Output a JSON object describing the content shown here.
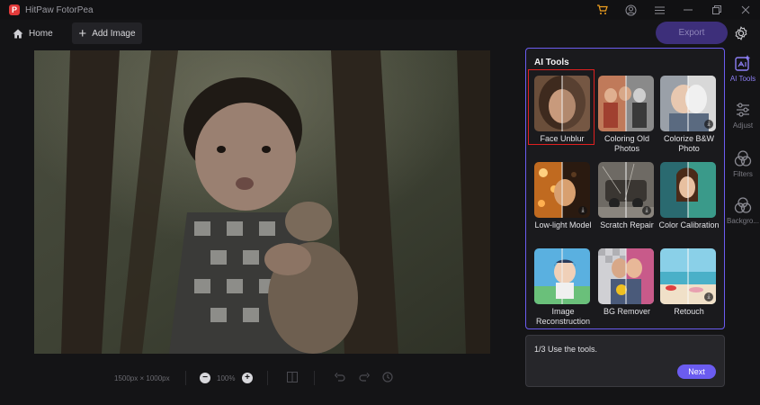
{
  "window": {
    "title": "HitPaw FotorPea",
    "logo_letter": "P"
  },
  "toolbar": {
    "home_label": "Home",
    "add_image_label": "Add Image",
    "export_label": "Export"
  },
  "canvas": {
    "image_size": "1500px × 1000px",
    "zoom": "100%"
  },
  "ai_tools": {
    "title": "AI Tools",
    "tools": [
      {
        "label": "Face Unblur",
        "selected": true,
        "downloadable": false
      },
      {
        "label": "Coloring Old Photos",
        "selected": false,
        "downloadable": false
      },
      {
        "label": "Colorize B&W Photo",
        "selected": false,
        "downloadable": true
      },
      {
        "label": "Low-light Model",
        "selected": false,
        "downloadable": true
      },
      {
        "label": "Scratch Repair",
        "selected": false,
        "downloadable": true
      },
      {
        "label": "Color Calibration",
        "selected": false,
        "downloadable": false
      },
      {
        "label": "Image Reconstruction",
        "selected": false,
        "downloadable": false
      },
      {
        "label": "BG Remover",
        "selected": false,
        "downloadable": false
      },
      {
        "label": "Retouch",
        "selected": false,
        "downloadable": true
      }
    ]
  },
  "tip": {
    "text": "1/3 Use the tools.",
    "next_label": "Next"
  },
  "sidebar": {
    "items": [
      {
        "label": "AI Tools",
        "active": true
      },
      {
        "label": "Adjust",
        "active": false
      },
      {
        "label": "Filters",
        "active": false
      },
      {
        "label": "Backgro...",
        "active": false
      }
    ]
  },
  "colors": {
    "accent": "#6b5cf0",
    "selection": "#e02020",
    "export_bg": "#3d2f7a"
  }
}
